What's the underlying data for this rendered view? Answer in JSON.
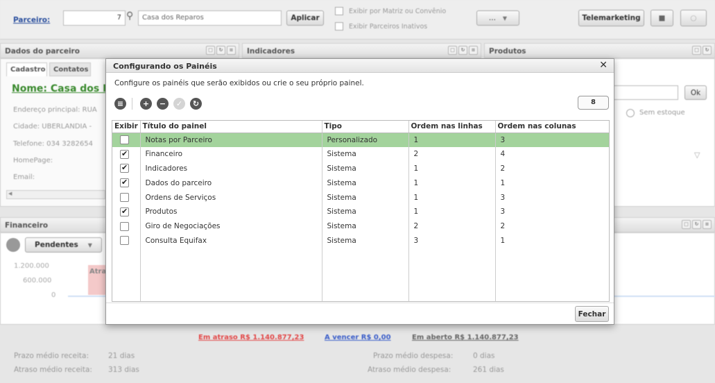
{
  "toolbar": {
    "parceiro_label": "Parceiro:",
    "parceiro_code": "7",
    "parceiro_name": "Casa dos Reparos",
    "aplicar": "Aplicar",
    "check_matriz": "Exibir por Matriz ou Convênio",
    "check_inativos": "Exibir Parceiros Inativos",
    "more": "...",
    "telemarketing": "Telemarketing"
  },
  "panels": {
    "dados": {
      "title": "Dados do parceiro",
      "tabs": [
        "Cadastro",
        "Contatos"
      ],
      "name": "Nome: Casa dos Re",
      "endereco": "Endereço principal: RUA",
      "cidade": "Cidade: UBERLANDIA -",
      "telefone": "Telefone: 034 3282654",
      "homepage": "HomePage:",
      "email": "Email:"
    },
    "indicadores": {
      "title": "Indicadores"
    },
    "produtos": {
      "title": "Produtos",
      "ok": "Ok",
      "sem_estoque": "Sem estoque"
    },
    "financeiro": {
      "title": "Financeiro",
      "pendentes": "Pendentes",
      "y_ticks": [
        "1.200.000",
        "600.000",
        "0"
      ],
      "bar_label": "Atra"
    }
  },
  "footer": {
    "em_atraso": "Em atraso R$ 1.140.877,23",
    "a_vencer": "A vencer R$ 0,00",
    "em_aberto": "Em aberto R$ 1.140.877,23",
    "prazo_receita_label": "Prazo médio receita:",
    "prazo_receita": "21 dias",
    "atraso_receita_label": "Atraso médio receita:",
    "atraso_receita": "313 dias",
    "prazo_despesa_label": "Prazo médio despesa:",
    "prazo_despesa": "0 dias",
    "atraso_despesa_label": "Atraso médio despesa:",
    "atraso_despesa": "261 dias"
  },
  "modal": {
    "title": "Configurando os Painéis",
    "description": "Configure os painéis que serão exibidos ou crie o seu próprio painel.",
    "count": "8",
    "columns": [
      "Exibir",
      "Título do painel",
      "Tipo",
      "Ordem nas linhas",
      "Ordem nas colunas"
    ],
    "rows": [
      {
        "checked": false,
        "title": "Notas por Parceiro",
        "tipo": "Personalizado",
        "linha": "1",
        "coluna": "3",
        "selected": true
      },
      {
        "checked": true,
        "title": "Financeiro",
        "tipo": "Sistema",
        "linha": "2",
        "coluna": "4"
      },
      {
        "checked": true,
        "title": "Indicadores",
        "tipo": "Sistema",
        "linha": "1",
        "coluna": "2"
      },
      {
        "checked": true,
        "title": "Dados do parceiro",
        "tipo": "Sistema",
        "linha": "1",
        "coluna": "1"
      },
      {
        "checked": false,
        "title": "Ordens de Serviços",
        "tipo": "Sistema",
        "linha": "1",
        "coluna": "3"
      },
      {
        "checked": true,
        "title": "Produtos",
        "tipo": "Sistema",
        "linha": "1",
        "coluna": "3"
      },
      {
        "checked": false,
        "title": "Giro de Negociações",
        "tipo": "Sistema",
        "linha": "2",
        "coluna": "2"
      },
      {
        "checked": false,
        "title": "Consulta Equifax",
        "tipo": "Sistema",
        "linha": "3",
        "coluna": "1"
      }
    ],
    "close": "Fechar"
  }
}
